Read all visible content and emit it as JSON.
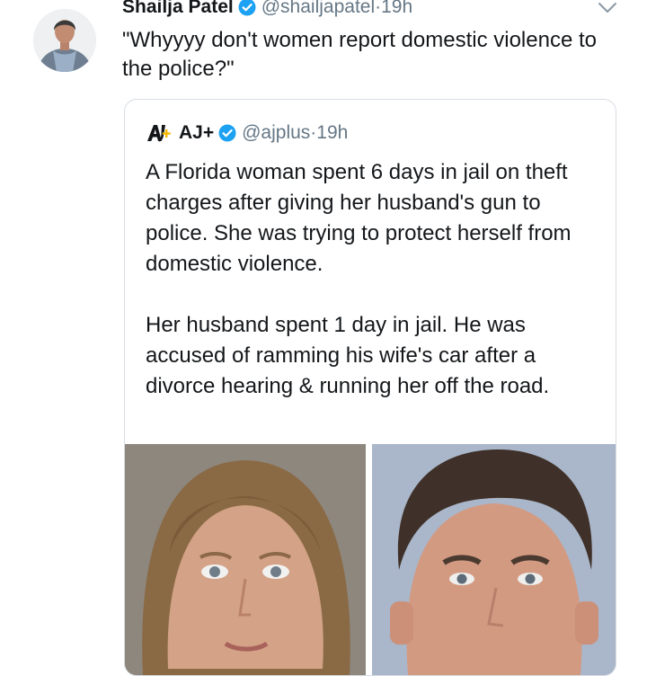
{
  "tweet": {
    "author_name": "Shailja Patel",
    "author_handle": "@shailjapatel",
    "time": "19h",
    "text": "\"Whyyyy don't women report domestic violence to the police?\""
  },
  "quoted_tweet": {
    "author_name": "AJ+",
    "author_handle": "@ajplus",
    "time": "19h",
    "paragraph1": "A Florida woman spent 6 days in jail on theft charges after giving her husband's gun to police. She was trying to protect herself from domestic violence.",
    "paragraph2": "Her husband spent 1 day in jail. He was accused of ramming his wife's car after a divorce hearing & running her off the road."
  },
  "separator": " · ",
  "colors": {
    "verified": "#1da1f2",
    "text": "#14171a",
    "secondary": "#657786",
    "border": "#d8dde2"
  },
  "icons": [
    "verified-badge-icon",
    "chevron-down-icon",
    "ajplus-logo-icon"
  ]
}
